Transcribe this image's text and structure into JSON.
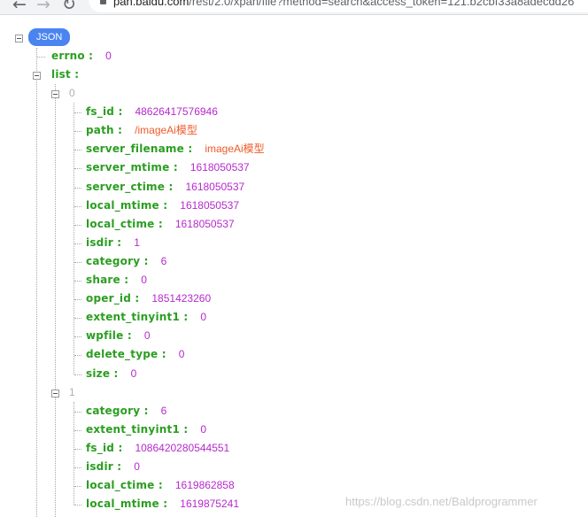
{
  "browser": {
    "back_icon": "arrow-left-icon",
    "forward_icon": "arrow-right-icon",
    "reload_icon": "reload-icon",
    "url_host": "pan.baidu.com",
    "url_path": "/rest/2.0/xpan/file?method=search&access_token=121.b2cbf33a8adecdd26"
  },
  "root": {
    "badge": "JSON",
    "errno": {
      "key": "errno :",
      "value": "0"
    },
    "list": {
      "key": "list :"
    }
  },
  "items": [
    {
      "index": "0",
      "fields": [
        {
          "key": "fs_id :",
          "value": "48626417576946",
          "type": "num"
        },
        {
          "key": "path :",
          "value": "/imageAi模型",
          "type": "str"
        },
        {
          "key": "server_filename :",
          "value": "imageAi模型",
          "type": "str"
        },
        {
          "key": "server_mtime :",
          "value": "1618050537",
          "type": "num"
        },
        {
          "key": "server_ctime :",
          "value": "1618050537",
          "type": "num"
        },
        {
          "key": "local_mtime :",
          "value": "1618050537",
          "type": "num"
        },
        {
          "key": "local_ctime :",
          "value": "1618050537",
          "type": "num"
        },
        {
          "key": "isdir :",
          "value": "1",
          "type": "num"
        },
        {
          "key": "category :",
          "value": "6",
          "type": "num"
        },
        {
          "key": "share :",
          "value": "0",
          "type": "num"
        },
        {
          "key": "oper_id :",
          "value": "1851423260",
          "type": "num"
        },
        {
          "key": "extent_tinyint1 :",
          "value": "0",
          "type": "num"
        },
        {
          "key": "wpfile :",
          "value": "0",
          "type": "num"
        },
        {
          "key": "delete_type :",
          "value": "0",
          "type": "num"
        },
        {
          "key": "size :",
          "value": "0",
          "type": "num"
        }
      ]
    },
    {
      "index": "1",
      "fields": [
        {
          "key": "category :",
          "value": "6",
          "type": "num"
        },
        {
          "key": "extent_tinyint1 :",
          "value": "0",
          "type": "num"
        },
        {
          "key": "fs_id :",
          "value": "1086420280544551",
          "type": "num"
        },
        {
          "key": "isdir :",
          "value": "0",
          "type": "num"
        },
        {
          "key": "local_ctime :",
          "value": "1619862858",
          "type": "num"
        },
        {
          "key": "local_mtime :",
          "value": "1619875241",
          "type": "num"
        }
      ]
    }
  ],
  "watermark": "https://blog.csdn.net/Baldprogrammer",
  "colors": {
    "key": "#2a9e20",
    "number": "#b629cc",
    "string": "#ef5a2a",
    "badge": "#4a84f0"
  }
}
